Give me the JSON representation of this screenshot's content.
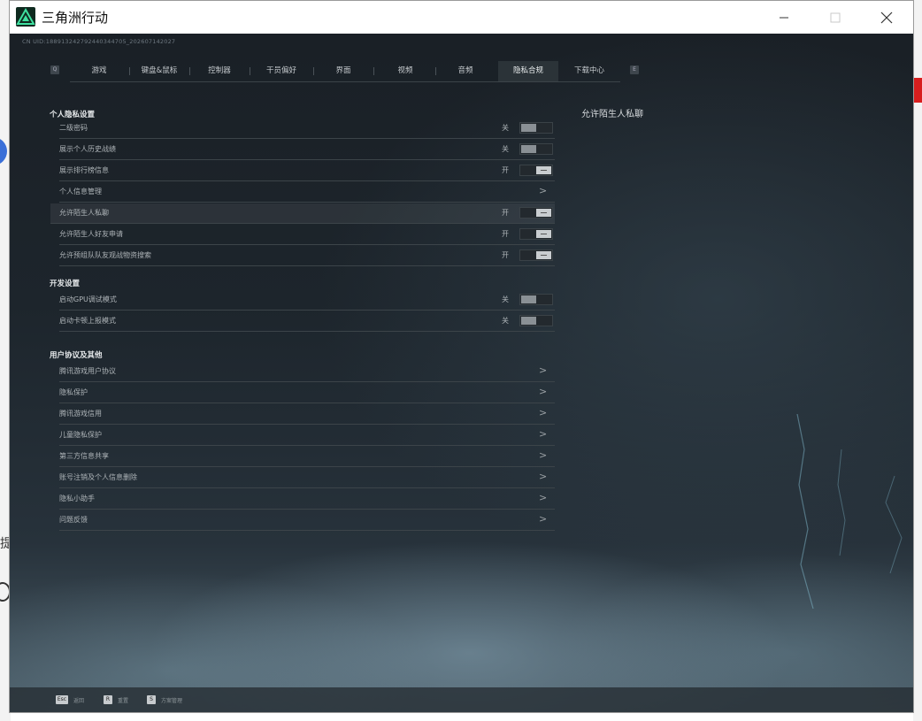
{
  "window": {
    "title": "三角洲行动",
    "minimize": "—",
    "maximize": "☐",
    "close": "✕"
  },
  "uid_text": "CN UID:18891324279244034470​5_202607142027",
  "tabs": {
    "left_key": "Q",
    "right_key": "E",
    "items": [
      {
        "label": "游戏",
        "active": false
      },
      {
        "label": "键盘&鼠标",
        "active": false
      },
      {
        "label": "控制器",
        "active": false
      },
      {
        "label": "干员偏好",
        "active": false
      },
      {
        "label": "界面",
        "active": false
      },
      {
        "label": "视频",
        "active": false
      },
      {
        "label": "音频",
        "active": false
      },
      {
        "label": "隐私合规",
        "active": true
      },
      {
        "label": "下载中心",
        "active": false
      }
    ]
  },
  "sections": {
    "personal": {
      "title": "个人隐私设置",
      "rows": [
        {
          "label": "二级密码",
          "state": "关",
          "on": false
        },
        {
          "label": "展示个人历史战绩",
          "state": "关",
          "on": false
        },
        {
          "label": "展示排行榜信息",
          "state": "开",
          "on": true
        },
        {
          "label": "个人信息管理",
          "chevron": ">"
        },
        {
          "label": "允许陌生人私聊",
          "state": "开",
          "on": true,
          "highlighted": true
        },
        {
          "label": "允许陌生人好友申请",
          "state": "开",
          "on": true
        },
        {
          "label": "允许预组队队友观战物资搜索",
          "state": "开",
          "on": true
        }
      ]
    },
    "dev": {
      "title": "开发设置",
      "rows": [
        {
          "label": "启动GPU调试模式",
          "state": "关",
          "on": false
        },
        {
          "label": "启动卡顿上报模式",
          "state": "关",
          "on": false
        }
      ]
    },
    "agreements": {
      "title": "用户协议及其他",
      "rows": [
        {
          "label": "腾讯游戏用户协议",
          "chevron": ">"
        },
        {
          "label": "隐私保护",
          "chevron": ">"
        },
        {
          "label": "腾讯游戏信用",
          "chevron": ">"
        },
        {
          "label": "儿童隐私保护",
          "chevron": ">"
        },
        {
          "label": "第三方信息共享",
          "chevron": ">"
        },
        {
          "label": "账号注销及个人信息删除",
          "chevron": ">"
        },
        {
          "label": "隐私小助手",
          "chevron": ">"
        },
        {
          "label": "问题反馈",
          "chevron": ">"
        }
      ]
    }
  },
  "detail_title": "允许陌生人私聊",
  "footer": [
    {
      "key": "Esc",
      "label": "返回"
    },
    {
      "key": "R",
      "label": "重置"
    },
    {
      "key": "S",
      "label": "方案管理"
    }
  ],
  "colors": {
    "accent": "#4fd6a3",
    "background": "#1d252c"
  }
}
